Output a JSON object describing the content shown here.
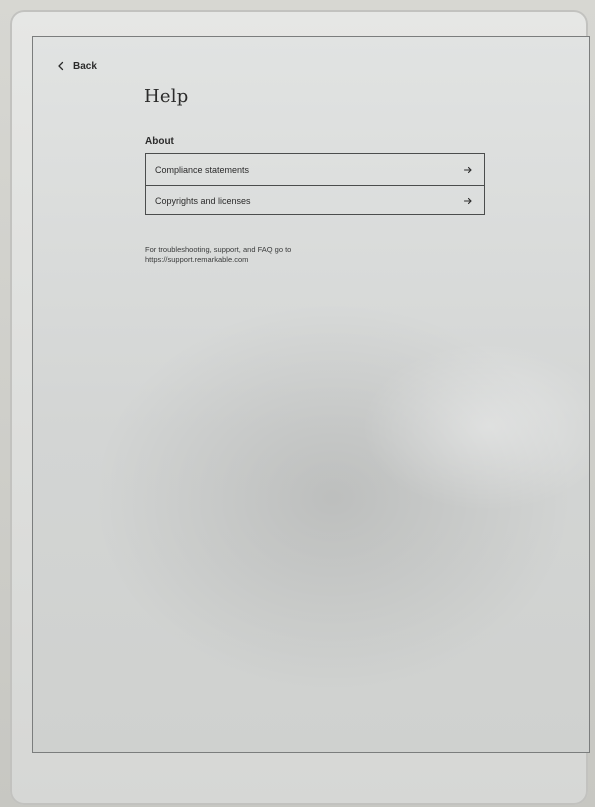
{
  "app": {
    "nav": {
      "back_label": "Back",
      "back_icon": "chevron-left-icon"
    },
    "page": {
      "title": "Help"
    },
    "about": {
      "section_title": "About",
      "items": [
        {
          "label": "Compliance statements",
          "icon": "arrow-right-icon"
        },
        {
          "label": "Copyrights and licenses",
          "icon": "arrow-right-icon"
        }
      ]
    },
    "support": {
      "line1": "For troubleshooting, support, and FAQ go to",
      "line2": "https://support.remarkable.com"
    }
  }
}
